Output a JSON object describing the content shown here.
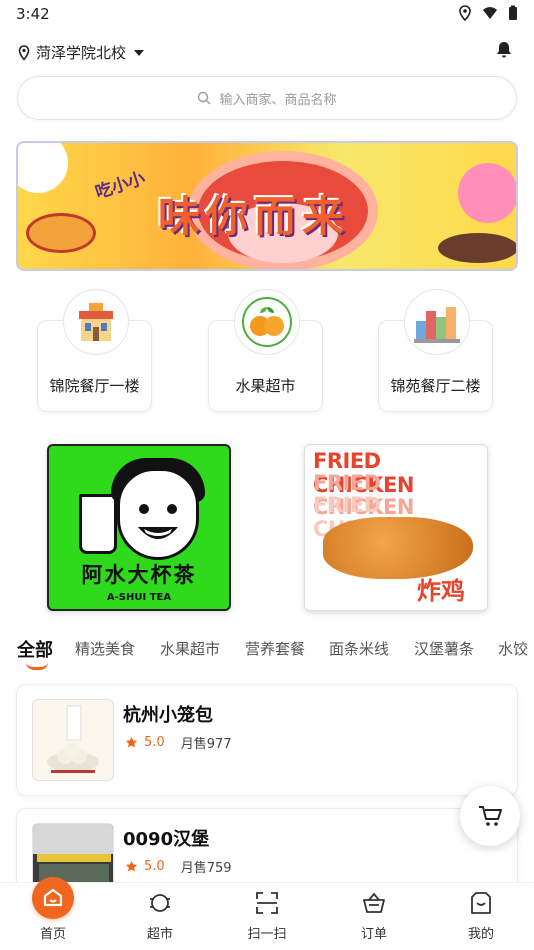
{
  "status": {
    "time": "3:42"
  },
  "header": {
    "location": "菏泽学院北校"
  },
  "search": {
    "placeholder": "输入商家、商品名称"
  },
  "banner": {
    "title": "味你而来",
    "subtitle": "吃小小"
  },
  "categories": [
    {
      "label": "锦院餐厅一楼",
      "icon": "restaurant-building-icon"
    },
    {
      "label": "水果超市",
      "icon": "oranges-icon"
    },
    {
      "label": "锦苑餐厅二楼",
      "icon": "city-buildings-icon"
    }
  ],
  "promos": [
    {
      "name": "阿水大杯茶",
      "sub": "A-SHUI TEA"
    },
    {
      "headline": "FRIED CHICKEN",
      "cn": "炸鸡"
    }
  ],
  "tabs": [
    {
      "label": "全部",
      "active": true
    },
    {
      "label": "精选美食"
    },
    {
      "label": "水果超市"
    },
    {
      "label": "营养套餐"
    },
    {
      "label": "面条米线"
    },
    {
      "label": "汉堡薯条"
    },
    {
      "label": "水饺"
    }
  ],
  "stores": [
    {
      "name": "杭州小笼包",
      "rating": "5.0",
      "sales": "月售977"
    },
    {
      "name": "0090汉堡",
      "rating": "5.0",
      "sales": "月售759"
    }
  ],
  "bottom_nav": [
    {
      "label": "首页",
      "icon": "home-icon",
      "active": true
    },
    {
      "label": "超市",
      "icon": "supermarket-icon"
    },
    {
      "label": "扫一扫",
      "icon": "scan-icon"
    },
    {
      "label": "订单",
      "icon": "order-basket-icon"
    },
    {
      "label": "我的",
      "icon": "profile-icon"
    }
  ],
  "colors": {
    "accent": "#f0661f",
    "promo_green": "#2fd91b",
    "fried_chicken_red": "#e7442e"
  }
}
